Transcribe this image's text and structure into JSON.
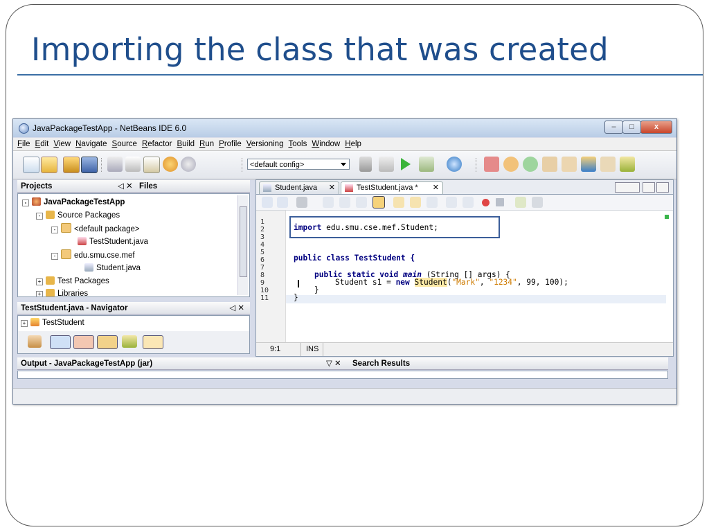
{
  "slide": {
    "title": "Importing the class that was created"
  },
  "window": {
    "title": "JavaPackageTestApp - NetBeans IDE 6.0",
    "controls": {
      "minimize": "–",
      "maximize": "□",
      "close": "x"
    }
  },
  "menu": [
    "File",
    "Edit",
    "View",
    "Navigate",
    "Source",
    "Refactor",
    "Build",
    "Run",
    "Profile",
    "Versioning",
    "Tools",
    "Window",
    "Help"
  ],
  "toolbar": {
    "config_selected": "<default config>"
  },
  "projects_panel": {
    "tab_projects": "Projects",
    "tab_files": "Files",
    "tree": {
      "project": "JavaPackageTestApp",
      "source_packages": "Source Packages",
      "default_package": "<default package>",
      "test_student": "TestStudent.java",
      "package": "edu.smu.cse.mef",
      "student": "Student.java",
      "test_packages": "Test Packages",
      "libraries": "Libraries"
    }
  },
  "navigator_panel": {
    "title": "TestStudent.java - Navigator",
    "item": "TestStudent"
  },
  "editor": {
    "tabs": [
      "Student.java",
      "TestStudent.java *"
    ],
    "line_numbers": [
      "1",
      "2",
      "3",
      "4",
      "5",
      "6",
      "7",
      "8",
      "9",
      "10",
      "11"
    ],
    "code": {
      "l2_kw": "import",
      "l2_rest": " edu.smu.cse.mef.Student;",
      "l6_kw": "public class",
      "l6_rest": " TestStudent {",
      "l8_kw": "public static void",
      "l8_method": "main",
      "l8_rest": " (String [] args) {",
      "l9_a": "Student s1 = ",
      "l9_kw": "new",
      "l9_cls": "Student",
      "l9_p1": "(",
      "l9_s1": "\"Mark\"",
      "l9_c1": ", ",
      "l9_s2": "\"1234\"",
      "l9_rest": ", 99, 100);",
      "l10": "}",
      "l11": "}"
    },
    "status_position": "9:1",
    "status_mode": "INS"
  },
  "output_panel": {
    "title": "Output - JavaPackageTestApp (jar)",
    "search_title": "Search Results"
  },
  "colors": {
    "title_blue": "#1f4e8c",
    "highlight_box": "#3b5e9a"
  }
}
